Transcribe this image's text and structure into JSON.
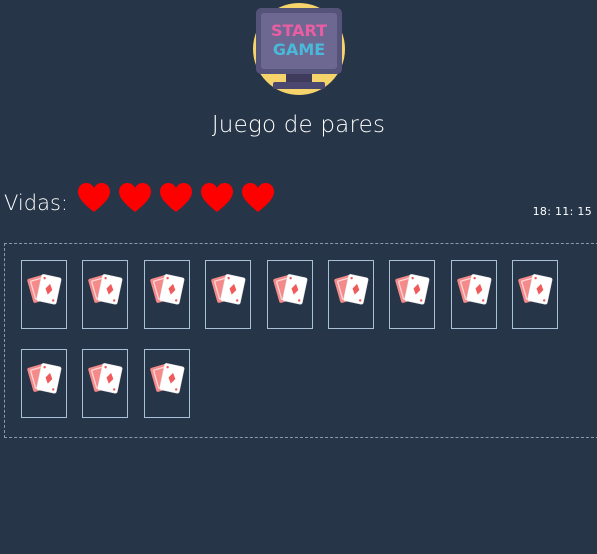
{
  "header": {
    "logo_line1": "START",
    "logo_line2": "GAME",
    "title": "Juego de pares"
  },
  "status": {
    "lives_label": "Vidas:",
    "lives": 5,
    "heart_color": "#ff0000",
    "clock": "18: 11: 15"
  },
  "board": {
    "card_count": 12,
    "card_icon": "playing-cards-icon",
    "cards_face_down": true
  }
}
